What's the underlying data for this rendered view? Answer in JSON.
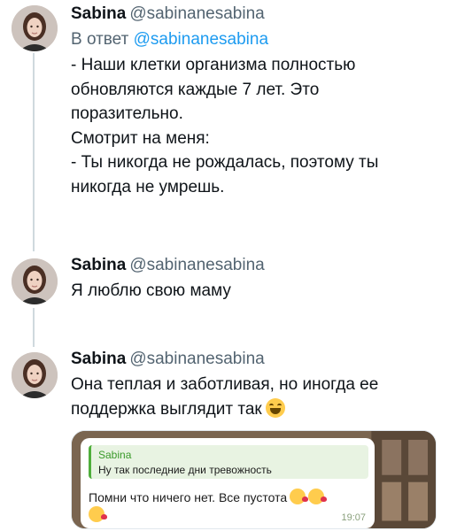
{
  "tweets": [
    {
      "author": "Sabina",
      "handle": "@sabinanesabina",
      "reply_prefix": "В ответ",
      "reply_to": "@sabinanesabina",
      "text": "- Наши клетки организма полностью\nобновляются каждые 7 лет. Это\nпоразительно.\nСмотрит на меня:\n- Ты никогда не рождалась, поэтому ты\nникогда не умрешь."
    },
    {
      "author": "Sabina",
      "handle": "@sabinanesabina",
      "text": "Я люблю свою маму"
    },
    {
      "author": "Sabina",
      "handle": "@sabinanesabina",
      "text": "Она теплая и заботливая, но иногда ее\nподдержка выглядит так"
    }
  ],
  "media": {
    "quote_author": "Sabina",
    "quote_text": "Ну так последние дни тревожность",
    "message": "Помни что ничего нет. Все пустота",
    "time": "19:07"
  },
  "colors": {
    "text": "#0f1419",
    "secondary": "#536471",
    "link": "#1d9bf0",
    "thread_line": "#cfd9de",
    "telegram_green": "#4fae3b"
  },
  "icons": {
    "grin_emoji": "grinning-face-emoji",
    "kiss_emoji": "kissing-heart-emoji"
  }
}
